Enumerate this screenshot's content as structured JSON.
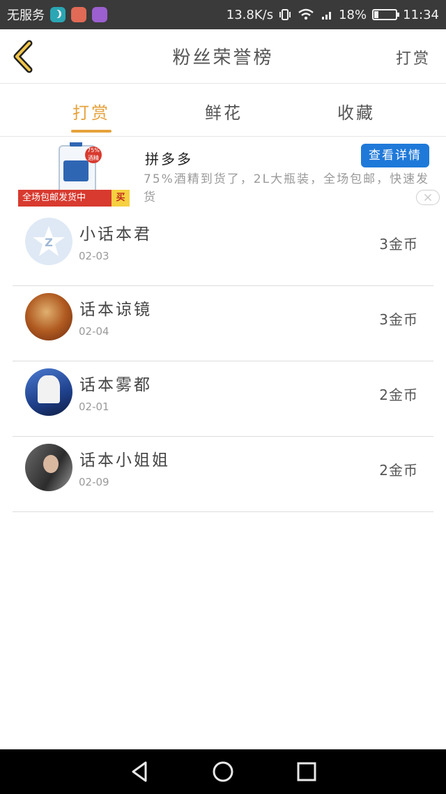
{
  "status_bar": {
    "carrier": "无服务",
    "speed": "13.8K/s",
    "battery_percent": "18%",
    "time": "11:34"
  },
  "header": {
    "title": "粉丝荣誉榜",
    "right_action": "打赏"
  },
  "tabs": [
    {
      "label": "打赏",
      "active": true
    },
    {
      "label": "鲜花",
      "active": false
    },
    {
      "label": "收藏",
      "active": false
    }
  ],
  "ad": {
    "brand": "拼多多",
    "description": "75%酒精到货了，2L大瓶装，全场包邮，快速发货",
    "cta_label": "查看详情",
    "thumb_banner": "全场包邮发货中",
    "thumb_buy": "买",
    "thumb_badge": "75%酒精"
  },
  "list": [
    {
      "name": "小话本君",
      "date": "02-03",
      "coins": "3金币"
    },
    {
      "name": "话本谅镜",
      "date": "02-04",
      "coins": "3金币"
    },
    {
      "name": "话本雾都",
      "date": "02-01",
      "coins": "2金币"
    },
    {
      "name": "话本小姐姐",
      "date": "02-09",
      "coins": "2金币"
    }
  ],
  "colors": {
    "accent": "#e6a23c",
    "ad_button": "#1f79d9",
    "status_bar": "#3a3a3a"
  }
}
